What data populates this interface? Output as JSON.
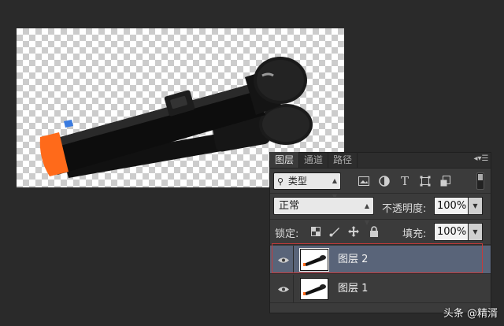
{
  "layers_panel": {
    "tabs": [
      "图层",
      "通道",
      "路径"
    ],
    "menu_icon": "panel-menu-icon",
    "filter": {
      "label": "类型",
      "icon": "search-icon"
    },
    "filter_icons": [
      "image-filter-icon",
      "adjustment-filter-icon",
      "text-filter-icon",
      "shape-filter-icon",
      "smart-object-filter-icon"
    ],
    "blend_mode": "正常",
    "opacity_label": "不透明度:",
    "opacity_value": "100%",
    "lock_label": "锁定:",
    "lock_icons": [
      "lock-transparent-icon",
      "lock-paint-icon",
      "lock-move-icon",
      "lock-all-icon"
    ],
    "fill_label": "填充:",
    "fill_value": "100%",
    "layers": [
      {
        "name": "图层 2",
        "selected": true,
        "visible": true
      },
      {
        "name": "图层 1",
        "selected": false,
        "visible": true
      }
    ]
  },
  "watermark": "头条 @精湑",
  "colors": {
    "background": "#2a2a2a",
    "panel": "#3b3b3b",
    "selected_layer": "#596479",
    "highlight_box": "#c63a3a",
    "microphone_accent": "#ff6a1a"
  }
}
